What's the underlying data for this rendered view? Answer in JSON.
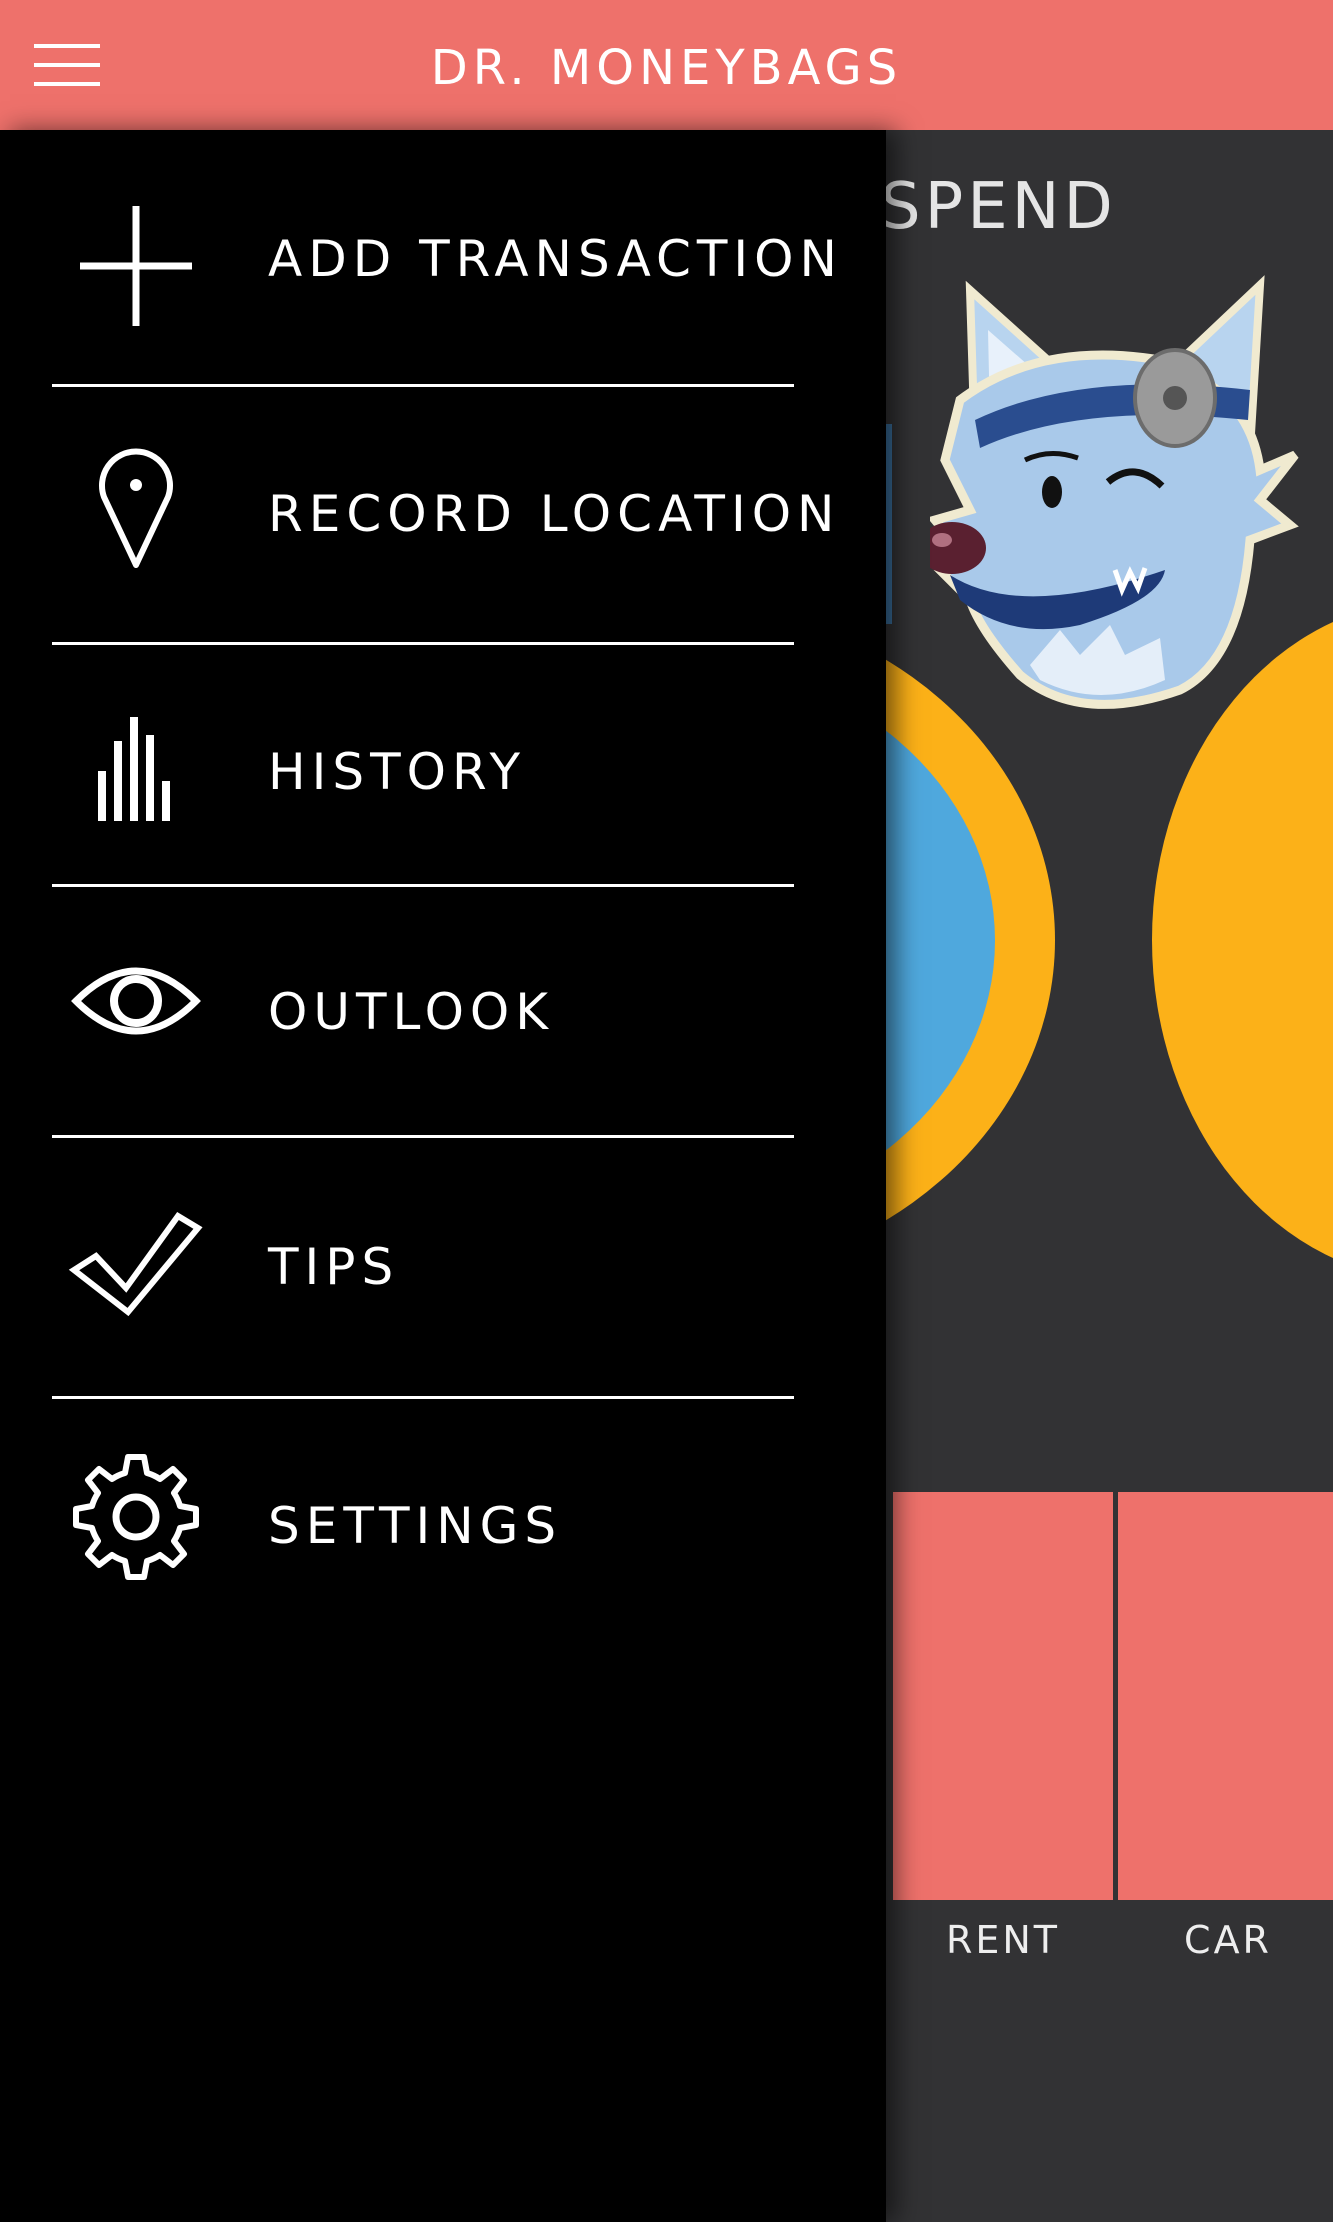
{
  "header": {
    "title": "DR. MONEYBAGS",
    "menu_icon": "hamburger-icon"
  },
  "background": {
    "title": "SPEND",
    "mascot": "wolf-doctor-mascot",
    "categories": [
      {
        "label": "RENT"
      },
      {
        "label": "CAR"
      }
    ]
  },
  "drawer": {
    "items": [
      {
        "label": "ADD TRANSACTION",
        "icon": "plus-icon"
      },
      {
        "label": "RECORD LOCATION",
        "icon": "location-pin-icon"
      },
      {
        "label": "HISTORY",
        "icon": "bar-chart-icon"
      },
      {
        "label": "OUTLOOK",
        "icon": "eye-icon"
      },
      {
        "label": "TIPS",
        "icon": "checkmark-icon"
      },
      {
        "label": "SETTINGS",
        "icon": "gear-icon"
      }
    ]
  },
  "colors": {
    "header_bg": "#ee716b",
    "drawer_bg": "#000000",
    "content_bg": "#323234",
    "accent_yellow": "#fcb118",
    "accent_blue": "#4fa8dd"
  }
}
